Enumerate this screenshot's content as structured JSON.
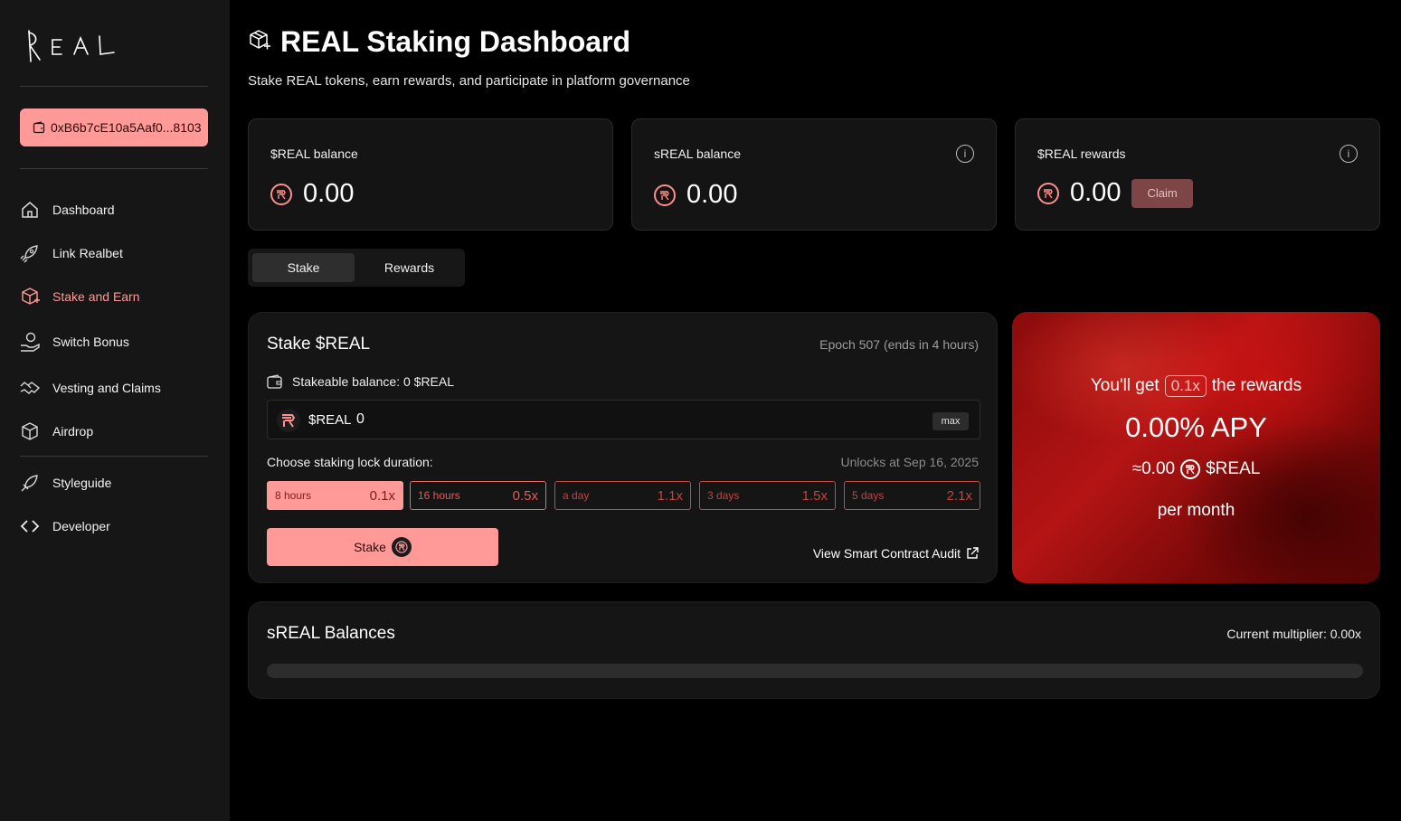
{
  "brand": {
    "logo_text": "REAL"
  },
  "wallet": {
    "address": "0xB6b7cE10a5Aaf0...8103"
  },
  "sidebar": {
    "items": [
      {
        "label": "Dashboard",
        "icon": "home-icon"
      },
      {
        "label": "Link Realbet",
        "icon": "rocket-icon"
      },
      {
        "label": "Stake and Earn",
        "icon": "box-plus-icon",
        "active": true
      },
      {
        "label": "Switch Bonus",
        "icon": "hand-coin-icon"
      },
      {
        "label": "Vesting and Claims",
        "icon": "hand-shake-icon"
      },
      {
        "label": "Airdrop",
        "icon": "cube-icon"
      }
    ],
    "secondary_items": [
      {
        "label": "Styleguide",
        "icon": "rocket-outline-icon"
      },
      {
        "label": "Developer",
        "icon": "code-icon"
      }
    ]
  },
  "header": {
    "title": "REAL Staking Dashboard",
    "subtitle": "Stake REAL tokens, earn rewards, and participate in platform governance"
  },
  "balances": {
    "real_balance": {
      "label": "$REAL balance",
      "value": "0.00"
    },
    "sreal_balance": {
      "label": "sREAL balance",
      "value": "0.00"
    },
    "real_rewards": {
      "label": "$REAL rewards",
      "value": "0.00",
      "claim_label": "Claim"
    }
  },
  "tabs": [
    {
      "label": "Stake",
      "active": true
    },
    {
      "label": "Rewards",
      "active": false
    }
  ],
  "stake": {
    "title": "Stake $REAL",
    "epoch": "Epoch 507 (ends in 4 hours)",
    "stakeable_balance": "Stakeable balance: 0 $REAL",
    "token_symbol": "$REAL",
    "amount_value": "0",
    "max_label": "max",
    "lock_label": "Choose staking lock duration:",
    "unlocks_at": "Unlocks at Sep 16, 2025",
    "durations": [
      {
        "label": "8 hours",
        "multiplier": "0.1x",
        "selected": true
      },
      {
        "label": "16 hours",
        "multiplier": "0.5x",
        "selected": false
      },
      {
        "label": "a day",
        "multiplier": "1.1x",
        "selected": false
      },
      {
        "label": "3 days",
        "multiplier": "1.5x",
        "selected": false
      },
      {
        "label": "5 days",
        "multiplier": "2.1x",
        "selected": false
      }
    ],
    "stake_button": "Stake",
    "audit_link": "View Smart Contract Audit"
  },
  "promo": {
    "prefix": "You'll get",
    "multiplier": "0.1x",
    "suffix": "the rewards",
    "apy": "0.00% APY",
    "approx": "≈0.00",
    "token": "$REAL",
    "period": "per month"
  },
  "sreal_balances": {
    "title": "sREAL Balances",
    "current_multiplier": "Current multiplier: 0.00x",
    "progress_fraction": 0
  },
  "colors": {
    "accent": "#ff9a98",
    "sidebar_bg": "#161616",
    "page_bg": "#000000",
    "card_bg": "#141414",
    "duration_border": "#e46b68"
  }
}
